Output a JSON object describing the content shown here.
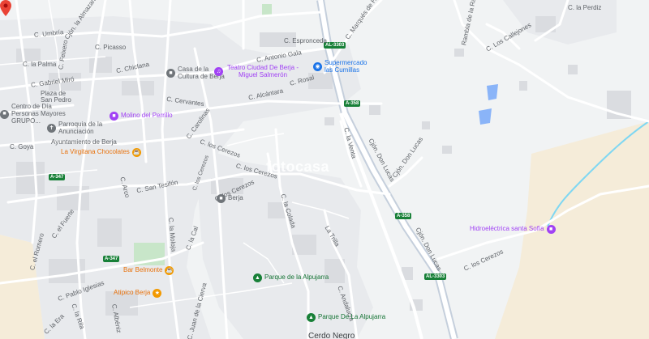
{
  "colors": {
    "background": "#f1f3f4",
    "road": "#ffffff",
    "road_outline": "#d5dae0",
    "building": "#dadce0",
    "urban_area": "#e8eaed",
    "highway": "#c5cfdc",
    "water": "#8ab4f8",
    "river": "#7fd7f2",
    "park": "#c8e6c9",
    "dry_land": "#f5ecd9",
    "pin": "#ea4335",
    "poi_purple": "#a142f4",
    "poi_orange": "#f29900",
    "poi_blue": "#1a73e8",
    "poi_green": "#188038",
    "shield": "#188038"
  },
  "watermark": "fotocasa",
  "streets": {
    "c_umbria": "C. Umbría",
    "c_picasso": "C. Picasso",
    "cjon_almazara": "Cjón. la Almazara",
    "c_esproncedo": "C. Espronceda",
    "c_antonio_gala": "C. Antonio Gala",
    "c_marques_hita": "C. Marqués de Hita",
    "rambla_ragua": "Rambla de la Ragua",
    "c_los_callejones": "C. Los Callejones",
    "c_la_perdiz": "C. la Perdiz",
    "c_la_palma": "C. la Palma",
    "c_feixero": "C. Feixero",
    "c_chiclana": "C. Chiclana",
    "c_gabriel_miro": "C. Gabriel Miró",
    "c_rosal": "C. Rosal",
    "c_alcantara": "C. Alcántara",
    "c_cervantes": "C. Cervantes",
    "c_carolinas": "C. Carolinas",
    "c_goya": "C. Goya",
    "c_los_cerezos_1": "C. los Cerezos",
    "c_los_cerezos_2": "C. los Cerezos",
    "c_los_cerezos_3": "C. los Cerezos",
    "c_la_venta": "C. la Venta",
    "cjon_don_lucas_1": "Cjón. Don Lucas",
    "cjon_don_lucas_2": "Cjón. Don Lucas",
    "cjon_don_lucas_3": "Cjón. Don Lucas",
    "c_los_cerezos_e": "C. los Cerezos",
    "c_arco": "C. Arco",
    "c_san_tesifon": "C. San Tesifón",
    "c_el_fuerte": "C. el Fuerte",
    "c_el_romero": "C. el Romero",
    "c_la_moloja": "C. la Moloja",
    "c_la_cal": "C. la Cal",
    "c_la_colada": "C. la Colada",
    "la_trilla": "La Trilla",
    "c_pablo_iglesias": "C. Pablo Iglesias",
    "c_la_rila": "C. la Rila",
    "c_albeniz": "C. Albéniz",
    "c_juan_de_la_cierva": "C. Juan de la Cierva",
    "c_andalucia": "C. Andalucía",
    "c_la_era": "C. la Era"
  },
  "roads": {
    "a_3303_top": "AL-3303",
    "a_358_mid": "A-358",
    "a_358_right": "A-358",
    "a_347_left": "A-347",
    "a_347_mid": "A-347",
    "al_3303_bottom": "AL-3303"
  },
  "pois": {
    "casa_cultura": "Casa de la Cultura de Berja",
    "teatro": "Teatro Ciudad De Berja - Miguel Salmerón",
    "supermercado": "Supermercado las Cumillas",
    "plaza_san_pedro": "Plaza de San Pedro",
    "centro_dia": "Centro de Día Personas Mayores GRUPO...",
    "molino": "Molino del Perrillo",
    "parroquia": "Parroquia de la Anunciación",
    "ayuntamiento": "Ayuntamiento de Berja",
    "virgitana": "La Virgitana Chocolates",
    "berja": "Berja",
    "hidroelectrica": "Hidroeléctrica santa Sofía",
    "bar_belmonte": "Bar Belmonte",
    "atipico": "Atípico Berja",
    "parque1": "Parque de la Alpujarra",
    "parque2": "Parque De La Alpujarra",
    "bottom_partial": "Cerdo Negro"
  },
  "icons": {
    "pin": "location-pin-icon",
    "theatre": "theatre-icon",
    "landmark": "landmark-icon",
    "cart": "shopping-cart-icon",
    "cafe": "cafe-icon",
    "restaurant": "restaurant-icon",
    "tree": "park-icon",
    "church": "church-icon"
  }
}
